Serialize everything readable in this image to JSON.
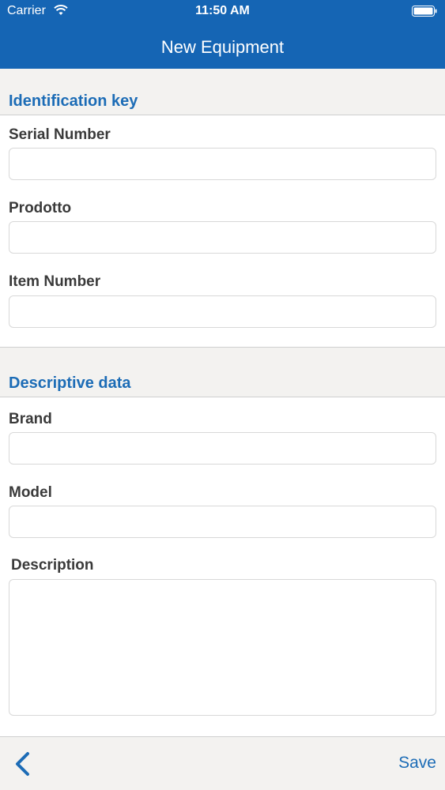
{
  "status_bar": {
    "carrier": "Carrier",
    "time": "11:50 AM"
  },
  "nav": {
    "title": "New Equipment"
  },
  "sections": {
    "identification": {
      "title": "Identification key",
      "serial_number": {
        "label": "Serial Number",
        "value": ""
      },
      "prodotto": {
        "label": "Prodotto",
        "value": ""
      },
      "item_number": {
        "label": "Item Number",
        "value": ""
      }
    },
    "descriptive": {
      "title": "Descriptive data",
      "brand": {
        "label": "Brand",
        "value": ""
      },
      "model": {
        "label": "Model",
        "value": ""
      },
      "description": {
        "label": "Description",
        "value": ""
      }
    }
  },
  "toolbar": {
    "back_icon": "chevron-left-icon",
    "save_label": "Save"
  },
  "colors": {
    "accent": "#1565b4",
    "link": "#1c6cb6",
    "section_bg": "#f3f2f0"
  }
}
